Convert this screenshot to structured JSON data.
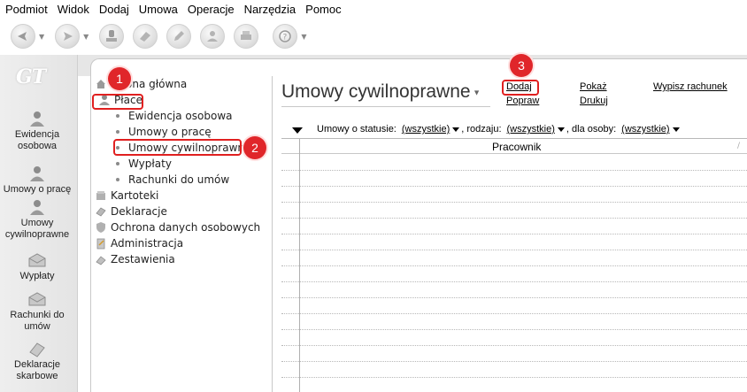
{
  "menu": [
    "Podmiot",
    "Widok",
    "Dodaj",
    "Umowa",
    "Operacje",
    "Narzędzia",
    "Pomoc"
  ],
  "logo_text": "GT",
  "sidebar": [
    {
      "label": "Ewidencja osobowa",
      "icon": "people-icon"
    },
    {
      "label": "Umowy o pracę",
      "icon": "people-icon"
    },
    {
      "label": "Umowy cywilnoprawne",
      "icon": "people-icon"
    },
    {
      "label": "Wypłaty",
      "icon": "envelope-icon"
    },
    {
      "label": "Rachunki do umów",
      "icon": "envelope-icon"
    },
    {
      "label": "Deklaracje skarbowe",
      "icon": "document-icon"
    }
  ],
  "tree": {
    "home": "Strona główna",
    "place": "Płace",
    "children": [
      "Ewidencja osobowa",
      "Umowy o pracę",
      "Umowy cywilnoprawne",
      "Wypłaty",
      "Rachunki do umów"
    ],
    "others": [
      "Kartoteki",
      "Deklaracje",
      "Ochrona danych osobowych",
      "Administracja",
      "Zestawienia"
    ]
  },
  "main": {
    "title": "Umowy cywilnoprawne",
    "actions": {
      "dodaj": "Dodaj",
      "popraw": "Popraw",
      "pokaz": "Pokaż",
      "drukuj": "Drukuj",
      "wypisz": "Wypisz rachunek"
    },
    "filter": {
      "status_label": "Umowy o statusie:",
      "status_value": "(wszystkie)",
      "rodzaj_label": ", rodzaju:",
      "rodzaj_value": "(wszystkie)",
      "osoba_label": ", dla osoby:",
      "osoba_value": "(wszystkie)"
    },
    "grid": {
      "column": "Pracownik",
      "sort_mark": "/"
    }
  },
  "annotations": [
    "1",
    "2",
    "3"
  ],
  "colors": {
    "annotation": "#e0262a",
    "sidebar_bg": "#e8e8e8"
  }
}
